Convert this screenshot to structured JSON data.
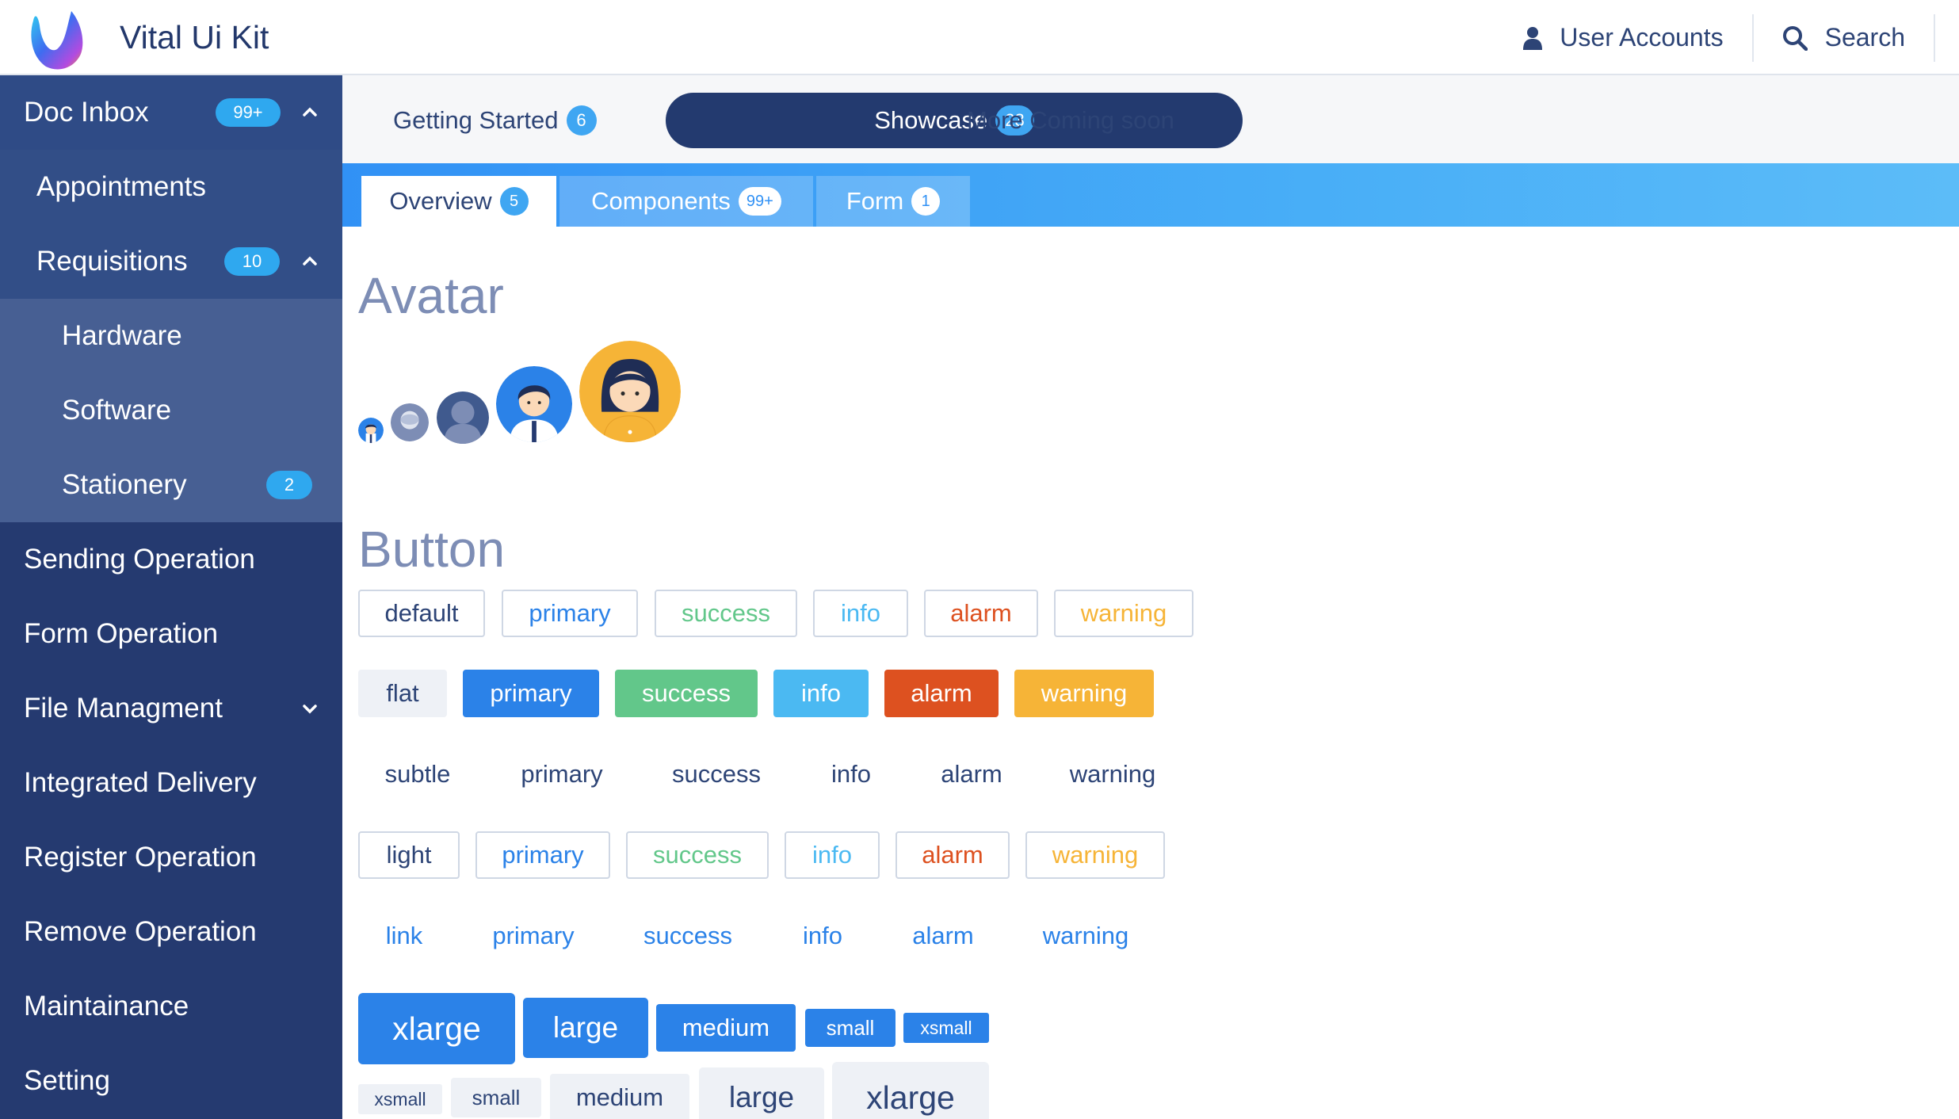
{
  "header": {
    "app_title": "Vital Ui Kit",
    "user_accounts": "User Accounts",
    "search": "Search",
    "icons": {
      "user": "user-icon",
      "search": "search-icon",
      "logo": "app-logo"
    }
  },
  "sidebar": {
    "items": [
      {
        "label": "Doc Inbox",
        "badge": "99+",
        "chevron": "up"
      },
      {
        "label": "Appointments"
      },
      {
        "label": "Requisitions",
        "badge": "10",
        "chevron": "up"
      },
      {
        "label": "Hardware"
      },
      {
        "label": "Software"
      },
      {
        "label": "Stationery",
        "badge": "2"
      },
      {
        "label": "Sending Operation"
      },
      {
        "label": "Form Operation"
      },
      {
        "label": "File Managment",
        "chevron": "down"
      },
      {
        "label": "Integrated Delivery"
      },
      {
        "label": "Register Operation"
      },
      {
        "label": "Remove Operation"
      },
      {
        "label": "Maintainance"
      },
      {
        "label": "Setting"
      }
    ]
  },
  "tabs": {
    "main": [
      {
        "label": "Getting Started",
        "badge": "6"
      },
      {
        "label": "Showcase",
        "badge": "23",
        "active": true
      },
      {
        "label": "More Coming soon"
      }
    ],
    "sub": [
      {
        "label": "Overview",
        "badge": "5",
        "active": true
      },
      {
        "label": "Components",
        "badge": "99+"
      },
      {
        "label": "Form",
        "badge": "1"
      }
    ]
  },
  "content": {
    "avatar_title": "Avatar",
    "button_title": "Button",
    "outline_row": [
      "default",
      "primary",
      "success",
      "info",
      "alarm",
      "warning"
    ],
    "flat_row": [
      "flat",
      "primary",
      "success",
      "info",
      "alarm",
      "warning"
    ],
    "subtle_row": [
      "subtle",
      "primary",
      "success",
      "info",
      "alarm",
      "warning"
    ],
    "light_row": [
      "light",
      "primary",
      "success",
      "info",
      "alarm",
      "warning"
    ],
    "link_row": [
      "link",
      "primary",
      "success",
      "info",
      "alarm",
      "warning"
    ],
    "size_primary_row": [
      "xlarge",
      "large",
      "medium",
      "small",
      "xsmall"
    ],
    "size_default_row": [
      "xsmall",
      "small",
      "medium",
      "large",
      "xlarge"
    ]
  },
  "colors": {
    "navy": "#253a70",
    "primary": "#2b82e8",
    "success": "#62c78a",
    "info": "#4bb9f2",
    "alarm": "#dd5120",
    "warning": "#f6b437",
    "default_text": "#2d4476"
  }
}
